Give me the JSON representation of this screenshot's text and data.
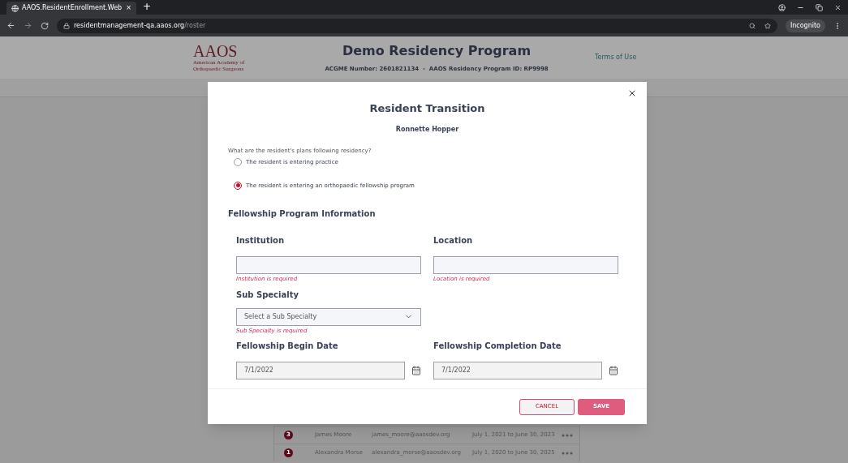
{
  "browser": {
    "tab_title": "AAOS.ResidentEnrollment.Web",
    "tab_close": "×",
    "new_tab": "+",
    "url_host": "residentmanagement-qa.aaos.org",
    "url_path": "/roster",
    "profile": "Incognito"
  },
  "header": {
    "logo_text": "AAOS",
    "logo_line_1": "American Academy of",
    "logo_line_2": "Orthopaedic Surgeons",
    "title": "Demo Residency Program",
    "subtitle": "ACGME Number: 2601821134  -  AAOS Residency Program ID: RP9998",
    "link": "Terms of Use"
  },
  "roster": [
    {
      "count": "3",
      "name": "James Moore",
      "email": "james_moore@aaosdev.org",
      "dates": "July 1, 2021 to June 30, 2023"
    },
    {
      "count": "1",
      "name": "Alexandra Morse",
      "email": "alexandra_morse@aaosdev.org",
      "dates": "July 1, 2020 to June 30, 2025"
    }
  ],
  "dialog": {
    "title": "Resident Transition",
    "resident": "Ronnette Hopper",
    "question": "What are the resident's plans following residency?",
    "options": [
      {
        "label": "The resident is entering practice",
        "selected": false
      },
      {
        "label": "The resident is entering an orthopaedic fellowship program",
        "selected": true
      }
    ],
    "section": "Fellowship Program Information",
    "institution": {
      "label": "Institution",
      "error": "Institution is required"
    },
    "location": {
      "label": "Location",
      "error": "Location is required"
    },
    "sub_specialty": {
      "label": "Sub Specialty",
      "placeholder": "Select a Sub Specialty",
      "error": "Sub Specialty is required"
    },
    "begin_date": {
      "label": "Fellowship Begin Date",
      "value": "7/1/2022"
    },
    "completion_date": {
      "label": "Fellowship Completion Date",
      "value": "7/1/2022"
    },
    "buttons": {
      "cancel": "CANCEL",
      "save": "SAVE"
    }
  }
}
